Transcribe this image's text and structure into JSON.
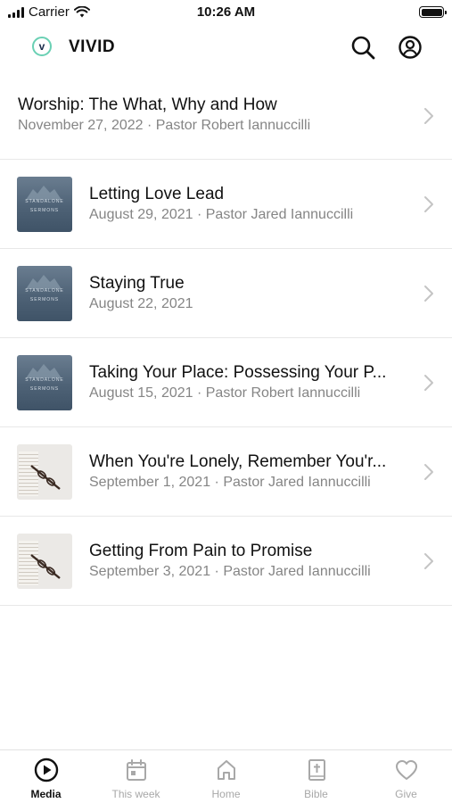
{
  "status_bar": {
    "carrier": "Carrier",
    "time": "10:26 AM",
    "icons": [
      "signal-icon",
      "wifi-icon",
      "battery-icon"
    ]
  },
  "header": {
    "logo_letter": "v",
    "title": "VIVID",
    "icons": [
      "search-icon",
      "account-icon"
    ]
  },
  "sermons": [
    {
      "title": "Worship: The What, Why and How",
      "subtitle": "November 27, 2022 · Pastor Robert Iannuccilli",
      "thumbnail": "none"
    },
    {
      "title": "Letting Love Lead",
      "subtitle": "August 29, 2021 · Pastor Jared Iannuccilli",
      "thumbnail": "standalone-sermons"
    },
    {
      "title": "Staying True",
      "subtitle": "August 22, 2021",
      "thumbnail": "standalone-sermons"
    },
    {
      "title": "Taking Your Place: Possessing Your P...",
      "subtitle": "August 15, 2021 · Pastor Robert Iannuccilli",
      "thumbnail": "standalone-sermons"
    },
    {
      "title": "When You're Lonely, Remember You'r...",
      "subtitle": "September 1, 2021 · Pastor Jared Iannuccilli",
      "thumbnail": "glasses-book"
    },
    {
      "title": "Getting From Pain to Promise",
      "subtitle": "September 3, 2021 · Pastor Jared Iannuccilli",
      "thumbnail": "glasses-book"
    }
  ],
  "thumbnail_text": {
    "line1": "STANDALONE",
    "line2": "SERMONS"
  },
  "tabs": [
    {
      "label": "Media",
      "icon": "play-circle-icon",
      "active": true
    },
    {
      "label": "This week",
      "icon": "calendar-icon",
      "active": false
    },
    {
      "label": "Home",
      "icon": "home-icon",
      "active": false
    },
    {
      "label": "Bible",
      "icon": "bible-icon",
      "active": false
    },
    {
      "label": "Give",
      "icon": "heart-icon",
      "active": false
    }
  ],
  "colors": {
    "accent": "#111111",
    "inactive_tab": "#a8a8a8",
    "subtitle": "#858585",
    "logo_ring": "#6ad0b4"
  }
}
